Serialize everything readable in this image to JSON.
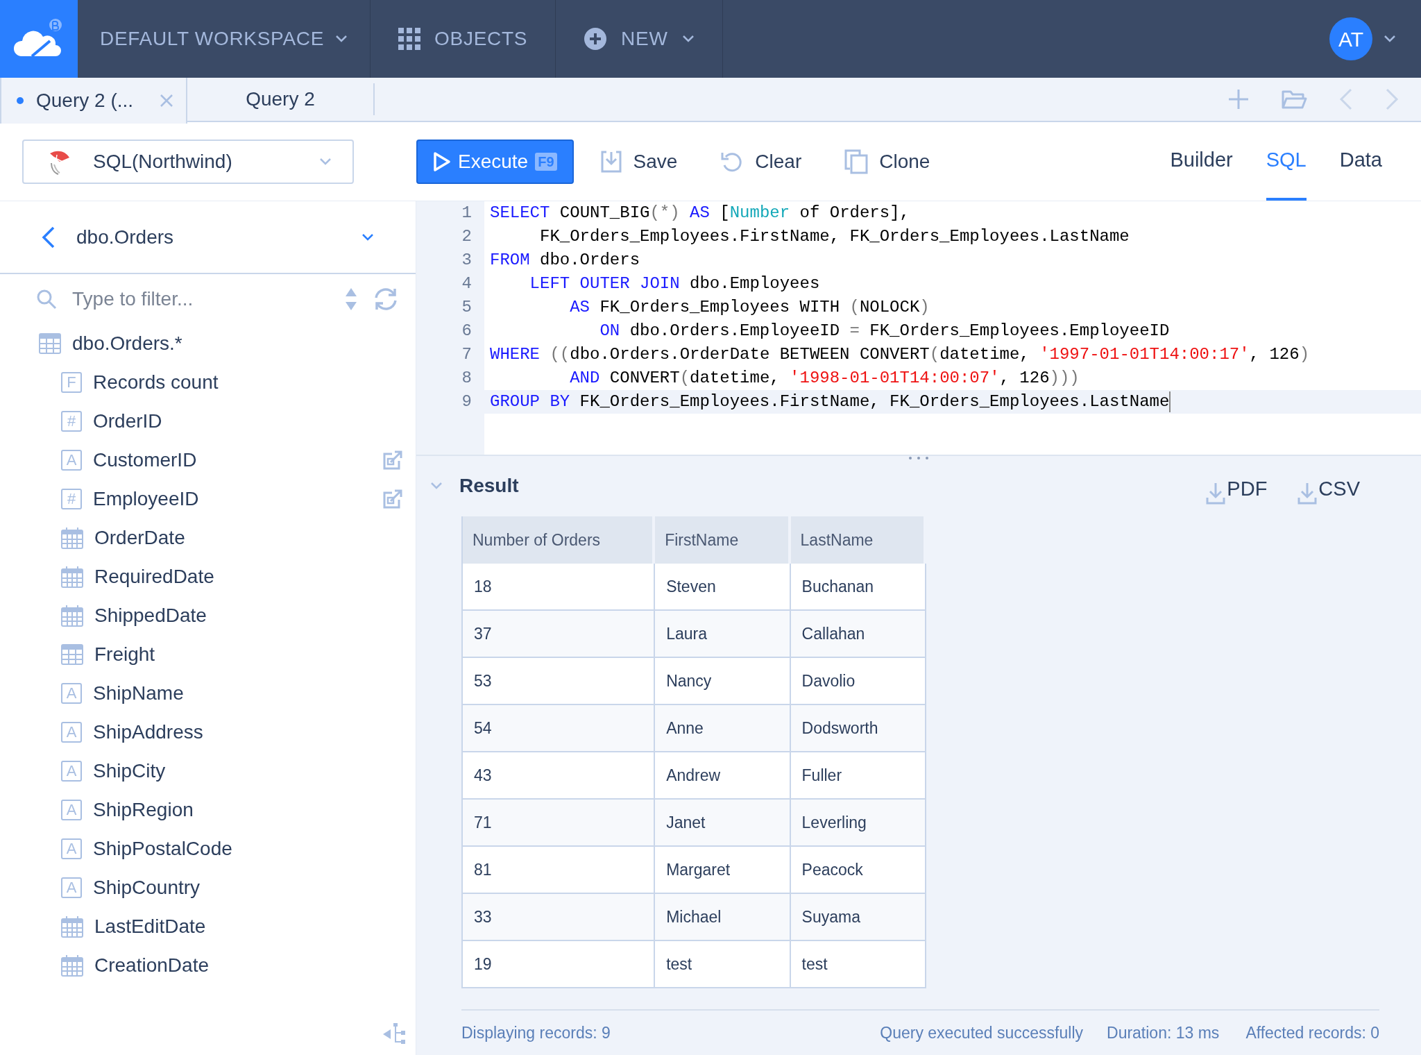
{
  "top_bar": {
    "workspace": "DEFAULT WORKSPACE",
    "objects": "OBJECTS",
    "new": "NEW",
    "avatar": "AT"
  },
  "tabs": [
    {
      "label": "Query 2 (...",
      "selected": true,
      "modified": true,
      "closable": true
    },
    {
      "label": "Query 2",
      "selected": false,
      "modified": false,
      "closable": false
    }
  ],
  "toolbar": {
    "data_source": "SQL(Northwind)",
    "execute": {
      "label": "Execute",
      "shortcut": "F9"
    },
    "actions": [
      {
        "kind": "save",
        "label": "Save"
      },
      {
        "kind": "clear",
        "label": "Clear"
      },
      {
        "kind": "clone",
        "label": "Clone"
      }
    ]
  },
  "view_tabs": [
    {
      "label": "Builder",
      "selected": false
    },
    {
      "label": "SQL",
      "selected": true
    },
    {
      "label": "Data",
      "selected": false
    }
  ],
  "sidebar": {
    "object": "dbo.Orders",
    "filter_placeholder": "Type to filter...",
    "tree": [
      {
        "label": "dbo.Orders.*",
        "kind": "table",
        "children": [
          {
            "label": "Records count",
            "kind": "formula",
            "badge": "F"
          },
          {
            "label": "OrderID",
            "kind": "number",
            "badge": "#"
          },
          {
            "label": "CustomerID",
            "kind": "text",
            "badge": "A",
            "link": true
          },
          {
            "label": "EmployeeID",
            "kind": "number",
            "badge": "#",
            "link": true
          },
          {
            "label": "OrderDate",
            "kind": "date"
          },
          {
            "label": "RequiredDate",
            "kind": "date"
          },
          {
            "label": "ShippedDate",
            "kind": "date"
          },
          {
            "label": "Freight",
            "kind": "table"
          },
          {
            "label": "ShipName",
            "kind": "text",
            "badge": "A"
          },
          {
            "label": "ShipAddress",
            "kind": "text",
            "badge": "A"
          },
          {
            "label": "ShipCity",
            "kind": "text",
            "badge": "A"
          },
          {
            "label": "ShipRegion",
            "kind": "text",
            "badge": "A"
          },
          {
            "label": "ShipPostalCode",
            "kind": "text",
            "badge": "A"
          },
          {
            "label": "ShipCountry",
            "kind": "text",
            "badge": "A"
          },
          {
            "label": "LastEditDate",
            "kind": "date"
          },
          {
            "label": "CreationDate",
            "kind": "date"
          }
        ]
      }
    ]
  },
  "editor": {
    "lines": [
      {
        "number": "1",
        "current": false,
        "tokens": [
          {
            "kind": "keyword",
            "text": "SELECT"
          },
          {
            "kind": "plain",
            "text": " COUNT_BIG"
          },
          {
            "kind": "op",
            "text": "(*)"
          },
          {
            "kind": "keyword",
            "text": " AS"
          },
          {
            "kind": "plain",
            "text": " ["
          },
          {
            "kind": "field",
            "text": "Number"
          },
          {
            "kind": "plain",
            "text": " of Orders],"
          }
        ]
      },
      {
        "number": "2",
        "current": false,
        "tokens": [
          {
            "kind": "plain",
            "text": "     FK_Orders_Employees.FirstName, FK_Orders_Employees.LastName"
          }
        ]
      },
      {
        "number": "3",
        "current": false,
        "tokens": [
          {
            "kind": "keyword",
            "text": "FROM"
          },
          {
            "kind": "plain",
            "text": " dbo.Orders"
          }
        ]
      },
      {
        "number": "4",
        "current": false,
        "tokens": [
          {
            "kind": "keyword",
            "text": "    LEFT OUTER JOIN"
          },
          {
            "kind": "plain",
            "text": " dbo.Employees"
          }
        ]
      },
      {
        "number": "5",
        "current": false,
        "tokens": [
          {
            "kind": "keyword",
            "text": "        AS"
          },
          {
            "kind": "plain",
            "text": " FK_Orders_Employees WITH "
          },
          {
            "kind": "op",
            "text": "("
          },
          {
            "kind": "plain",
            "text": "NOLOCK"
          },
          {
            "kind": "op",
            "text": ")"
          }
        ]
      },
      {
        "number": "6",
        "current": false,
        "tokens": [
          {
            "kind": "keyword",
            "text": "           ON"
          },
          {
            "kind": "plain",
            "text": " dbo.Orders.EmployeeID "
          },
          {
            "kind": "op",
            "text": "="
          },
          {
            "kind": "plain",
            "text": " FK_Orders_Employees.EmployeeID"
          }
        ]
      },
      {
        "number": "7",
        "current": false,
        "tokens": [
          {
            "kind": "keyword",
            "text": "WHERE"
          },
          {
            "kind": "op",
            "text": " (("
          },
          {
            "kind": "plain",
            "text": "dbo.Orders.OrderDate BETWEEN CONVERT"
          },
          {
            "kind": "op",
            "text": "("
          },
          {
            "kind": "plain",
            "text": "datetime, "
          },
          {
            "kind": "string",
            "text": "'1997-01-01T14:00:17'"
          },
          {
            "kind": "plain",
            "text": ", 126"
          },
          {
            "kind": "op",
            "text": ")"
          }
        ]
      },
      {
        "number": "8",
        "current": false,
        "tokens": [
          {
            "kind": "keyword",
            "text": "        AND"
          },
          {
            "kind": "plain",
            "text": " CONVERT"
          },
          {
            "kind": "op",
            "text": "("
          },
          {
            "kind": "plain",
            "text": "datetime, "
          },
          {
            "kind": "string",
            "text": "'1998-01-01T14:00:07'"
          },
          {
            "kind": "plain",
            "text": ", 126"
          },
          {
            "kind": "op",
            "text": ")))"
          }
        ]
      },
      {
        "number": "9",
        "current": true,
        "tokens": [
          {
            "kind": "keyword",
            "text": "GROUP BY"
          },
          {
            "kind": "plain",
            "text": " FK_Orders_Employees.FirstName, FK_Orders_Employees.LastName"
          }
        ]
      }
    ]
  },
  "result": {
    "title": "Result",
    "exports": [
      "PDF",
      "CSV"
    ],
    "table": {
      "columns": [
        "Number of Orders",
        "FirstName",
        "LastName"
      ],
      "rows": [
        [
          "18",
          "Steven",
          "Buchanan"
        ],
        [
          "37",
          "Laura",
          "Callahan"
        ],
        [
          "53",
          "Nancy",
          "Davolio"
        ],
        [
          "54",
          "Anne",
          "Dodsworth"
        ],
        [
          "43",
          "Andrew",
          "Fuller"
        ],
        [
          "71",
          "Janet",
          "Leverling"
        ],
        [
          "81",
          "Margaret",
          "Peacock"
        ],
        [
          "33",
          "Michael",
          "Suyama"
        ],
        [
          "19",
          "test",
          "test"
        ]
      ]
    },
    "status": {
      "records": "Displaying records: 9",
      "message": "Query executed successfully",
      "duration": "Duration: 13 ms",
      "affected": "Affected records: 0"
    }
  }
}
